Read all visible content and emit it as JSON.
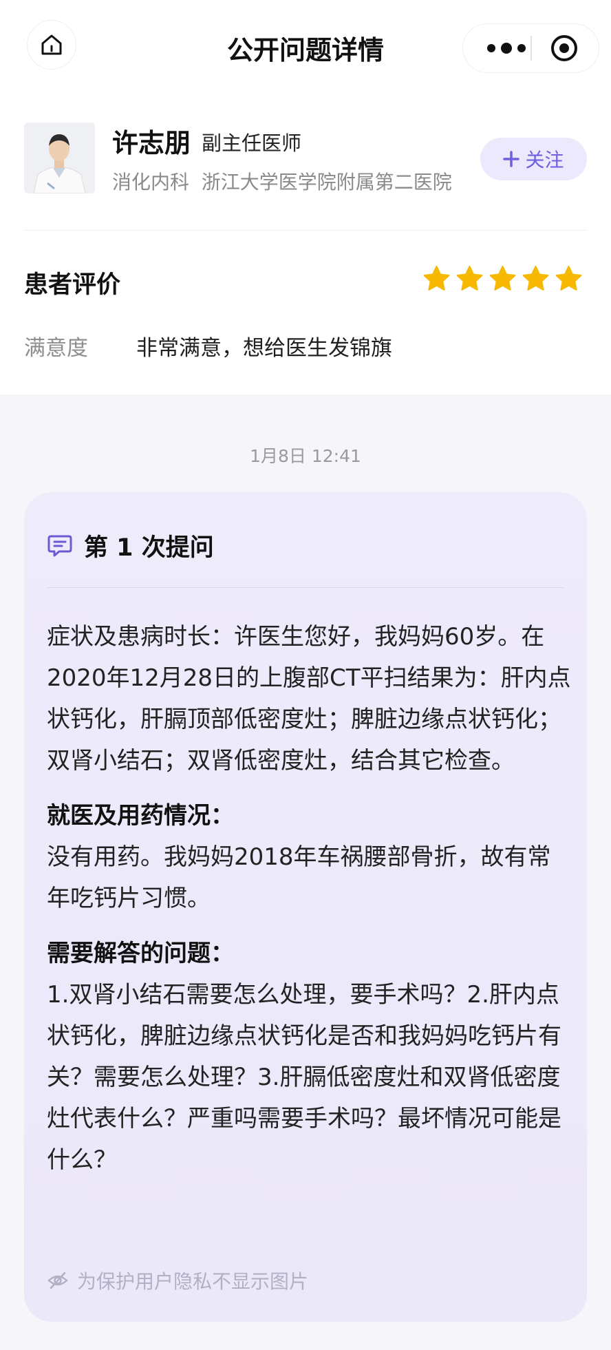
{
  "nav": {
    "title": "公开问题详情"
  },
  "doctor": {
    "name": "许志朋",
    "title": "副主任医师",
    "department": "消化内科  浙江大学医学院附属第二医院",
    "follow_label": "关注"
  },
  "review": {
    "title": "患者评价",
    "rating": 5,
    "rating_max": 5,
    "satisfaction_label": "满意度",
    "satisfaction_value": "非常满意，想给医生发锦旗"
  },
  "consultation": {
    "timestamp": "1月8日 12:41",
    "heading": "第 1 次提问",
    "symptoms": "症状及患病时长：许医生您好，我妈妈60岁。在2020年12月28日的上腹部CT平扫结果为：肝内点状钙化，肝膈顶部低密度灶；脾脏边缘点状钙化；双肾小结石；双肾低密度灶，结合其它检查。",
    "medication_title": "就医及用药情况：",
    "medication": "没有用药。我妈妈2018年车祸腰部骨折，故有常年吃钙片习惯。",
    "questions_title": "需要解答的问题：",
    "questions": "1.双肾小结石需要怎么处理，要手术吗？2.肝内点状钙化，脾脏边缘点状钙化是否和我妈妈吃钙片有关？需要怎么处理？3.肝膈低密度灶和双肾低密度灶代表什么？严重吗需要手术吗？最坏情况可能是什么？",
    "privacy_note": "为保护用户隐私不显示图片"
  },
  "colors": {
    "accent": "#7060e0",
    "star": "#f6b800",
    "card_bg": "#eeebfb",
    "page_grey": "#f6f5fa"
  },
  "icons": [
    "home-icon",
    "more-icon",
    "target-icon",
    "plus-icon",
    "star-icon",
    "chat-icon",
    "eye-hidden-icon"
  ]
}
